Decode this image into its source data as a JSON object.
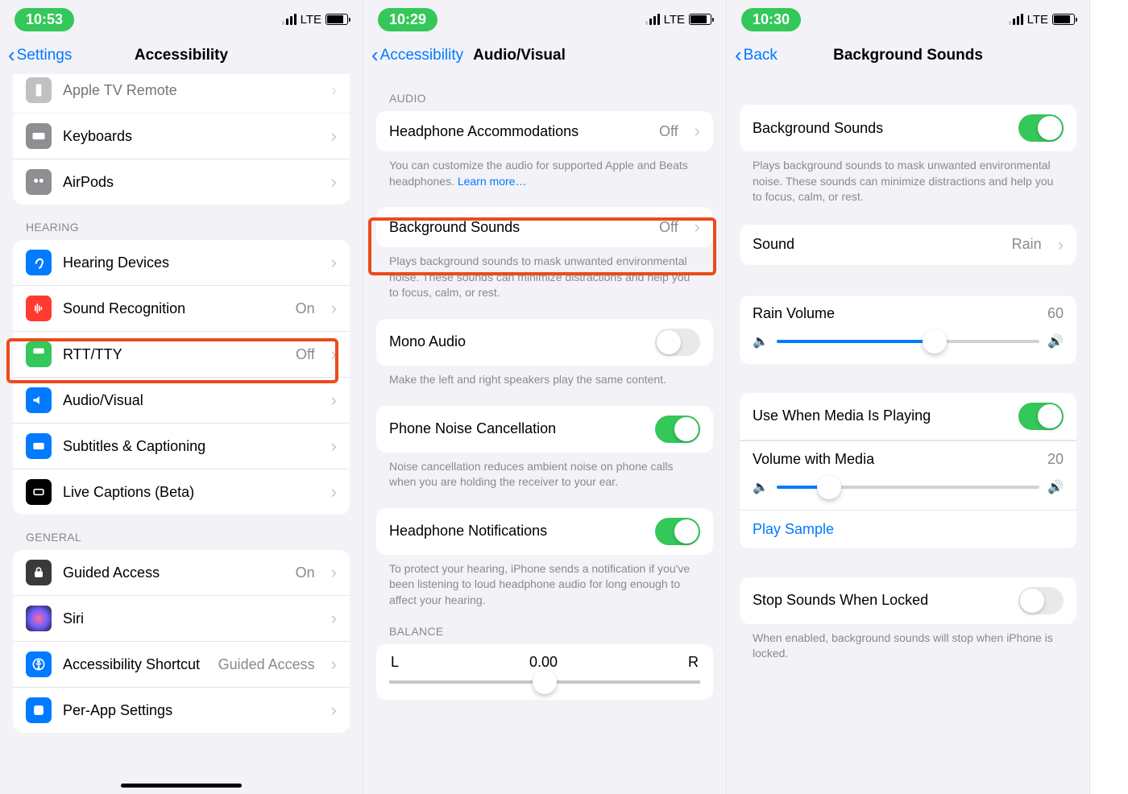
{
  "screens": [
    {
      "status": {
        "time": "10:53",
        "network": "LTE"
      },
      "nav": {
        "back": "Settings",
        "title": "Accessibility"
      },
      "top_rows": [
        {
          "icon": "tv-remote-icon",
          "bg": "#8e8e93",
          "label": "Apple TV Remote"
        },
        {
          "icon": "keyboard-icon",
          "bg": "#8e8e93",
          "label": "Keyboards"
        },
        {
          "icon": "airpods-icon",
          "bg": "#8e8e93",
          "label": "AirPods"
        }
      ],
      "hearing_label": "HEARING",
      "hearing_rows": [
        {
          "icon": "ear-icon",
          "bg": "#007aff",
          "label": "Hearing Devices",
          "value": ""
        },
        {
          "icon": "waveform-icon",
          "bg": "#ff3b30",
          "label": "Sound Recognition",
          "value": "On"
        },
        {
          "icon": "phone-icon",
          "bg": "#34c759",
          "label": "RTT/TTY",
          "value": "Off"
        },
        {
          "icon": "eye-speaker-icon",
          "bg": "#007aff",
          "label": "Audio/Visual",
          "value": ""
        },
        {
          "icon": "caption-icon",
          "bg": "#007aff",
          "label": "Subtitles & Captioning",
          "value": ""
        },
        {
          "icon": "live-caption-icon",
          "bg": "#000",
          "label": "Live Captions (Beta)",
          "value": ""
        }
      ],
      "general_label": "GENERAL",
      "general_rows": [
        {
          "icon": "lock-icon",
          "bg": "#3a3a3c",
          "label": "Guided Access",
          "value": "On"
        },
        {
          "icon": "siri-icon",
          "bg": "#1c1c1e",
          "label": "Siri",
          "value": ""
        },
        {
          "icon": "accessibility-icon",
          "bg": "#007aff",
          "label": "Accessibility Shortcut",
          "value": "Guided Access"
        },
        {
          "icon": "per-app-icon",
          "bg": "#007aff",
          "label": "Per-App Settings",
          "value": ""
        }
      ]
    },
    {
      "status": {
        "time": "10:29",
        "network": "LTE"
      },
      "nav": {
        "back": "Accessibility",
        "title": "Audio/Visual"
      },
      "audio_label": "AUDIO",
      "headphone_acc": {
        "label": "Headphone Accommodations",
        "value": "Off"
      },
      "headphone_footer": "You can customize the audio for supported Apple and Beats headphones.",
      "learn_more": "Learn more…",
      "bg_sounds": {
        "label": "Background Sounds",
        "value": "Off"
      },
      "bg_sounds_footer": "Plays background sounds to mask unwanted environmental noise. These sounds can minimize distractions and help you to focus, calm, or rest.",
      "mono": {
        "label": "Mono Audio",
        "on": false
      },
      "mono_footer": "Make the left and right speakers play the same content.",
      "noise": {
        "label": "Phone Noise Cancellation",
        "on": true
      },
      "noise_footer": "Noise cancellation reduces ambient noise on phone calls when you are holding the receiver to your ear.",
      "hp_notif": {
        "label": "Headphone Notifications",
        "on": true
      },
      "hp_notif_footer": "To protect your hearing, iPhone sends a notification if you've been listening to loud headphone audio for long enough to affect your hearing.",
      "balance_label": "BALANCE",
      "balance": {
        "left": "L",
        "center": "0.00",
        "right": "R"
      }
    },
    {
      "status": {
        "time": "10:30",
        "network": "LTE"
      },
      "nav": {
        "back": "Back",
        "title": "Background Sounds"
      },
      "main_toggle": {
        "label": "Background Sounds",
        "on": true
      },
      "main_footer": "Plays background sounds to mask unwanted environmental noise. These sounds can minimize distractions and help you to focus, calm, or rest.",
      "sound_row": {
        "label": "Sound",
        "value": "Rain"
      },
      "rain_volume": {
        "label": "Rain Volume",
        "value": "60",
        "pct": 60
      },
      "media_toggle": {
        "label": "Use When Media Is Playing",
        "on": true
      },
      "media_volume": {
        "label": "Volume with Media",
        "value": "20",
        "pct": 20
      },
      "play_sample": "Play Sample",
      "stop_locked": {
        "label": "Stop Sounds When Locked",
        "on": false
      },
      "stop_footer": "When enabled, background sounds will stop when iPhone is locked."
    }
  ]
}
